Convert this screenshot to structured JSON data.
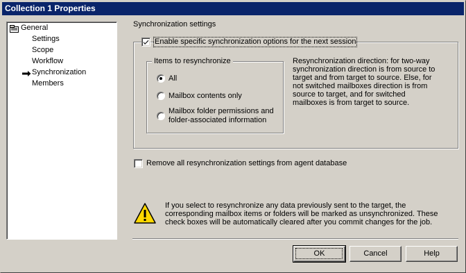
{
  "window": {
    "title": "Collection 1 Properties"
  },
  "tree": {
    "items": [
      {
        "label": "General",
        "icon": "folder-properties-icon"
      },
      {
        "label": "Settings"
      },
      {
        "label": "Scope"
      },
      {
        "label": "Workflow"
      },
      {
        "label": "Synchronization",
        "selected": true,
        "icon": "arrow-right-icon"
      },
      {
        "label": "Members"
      }
    ]
  },
  "sync": {
    "section_title": "Synchronization settings",
    "enable_label": "Enable specific synchronization options for the next session",
    "enable_checked": true,
    "items_group_label": "Items to resynchronize",
    "options": [
      {
        "label": "All",
        "selected": true
      },
      {
        "label": "Mailbox contents only",
        "selected": false
      },
      {
        "label_line1": "Mailbox folder permissions and",
        "label_line2": "folder-associated information",
        "selected": false
      }
    ],
    "direction_text": "Resynchronization direction: for two-way synchronization direction is from source to target and from target to source. Else, for not switched mailboxes direction is from source to target, and for switched mailboxes is from target to source.",
    "remove_label": "Remove all resynchronization settings from agent database",
    "remove_checked": false,
    "warning_text": "If you select to resynchronize any data previously sent to the target, the corresponding mailbox items or folders will be marked as unsynchronized. These check boxes will be automatically cleared after you commit changes for the job."
  },
  "buttons": {
    "ok": "OK",
    "cancel": "Cancel",
    "help": "Help"
  },
  "colors": {
    "titlebar": "#0a246a",
    "face": "#d4d0c8",
    "warning_yellow": "#ffd800"
  }
}
